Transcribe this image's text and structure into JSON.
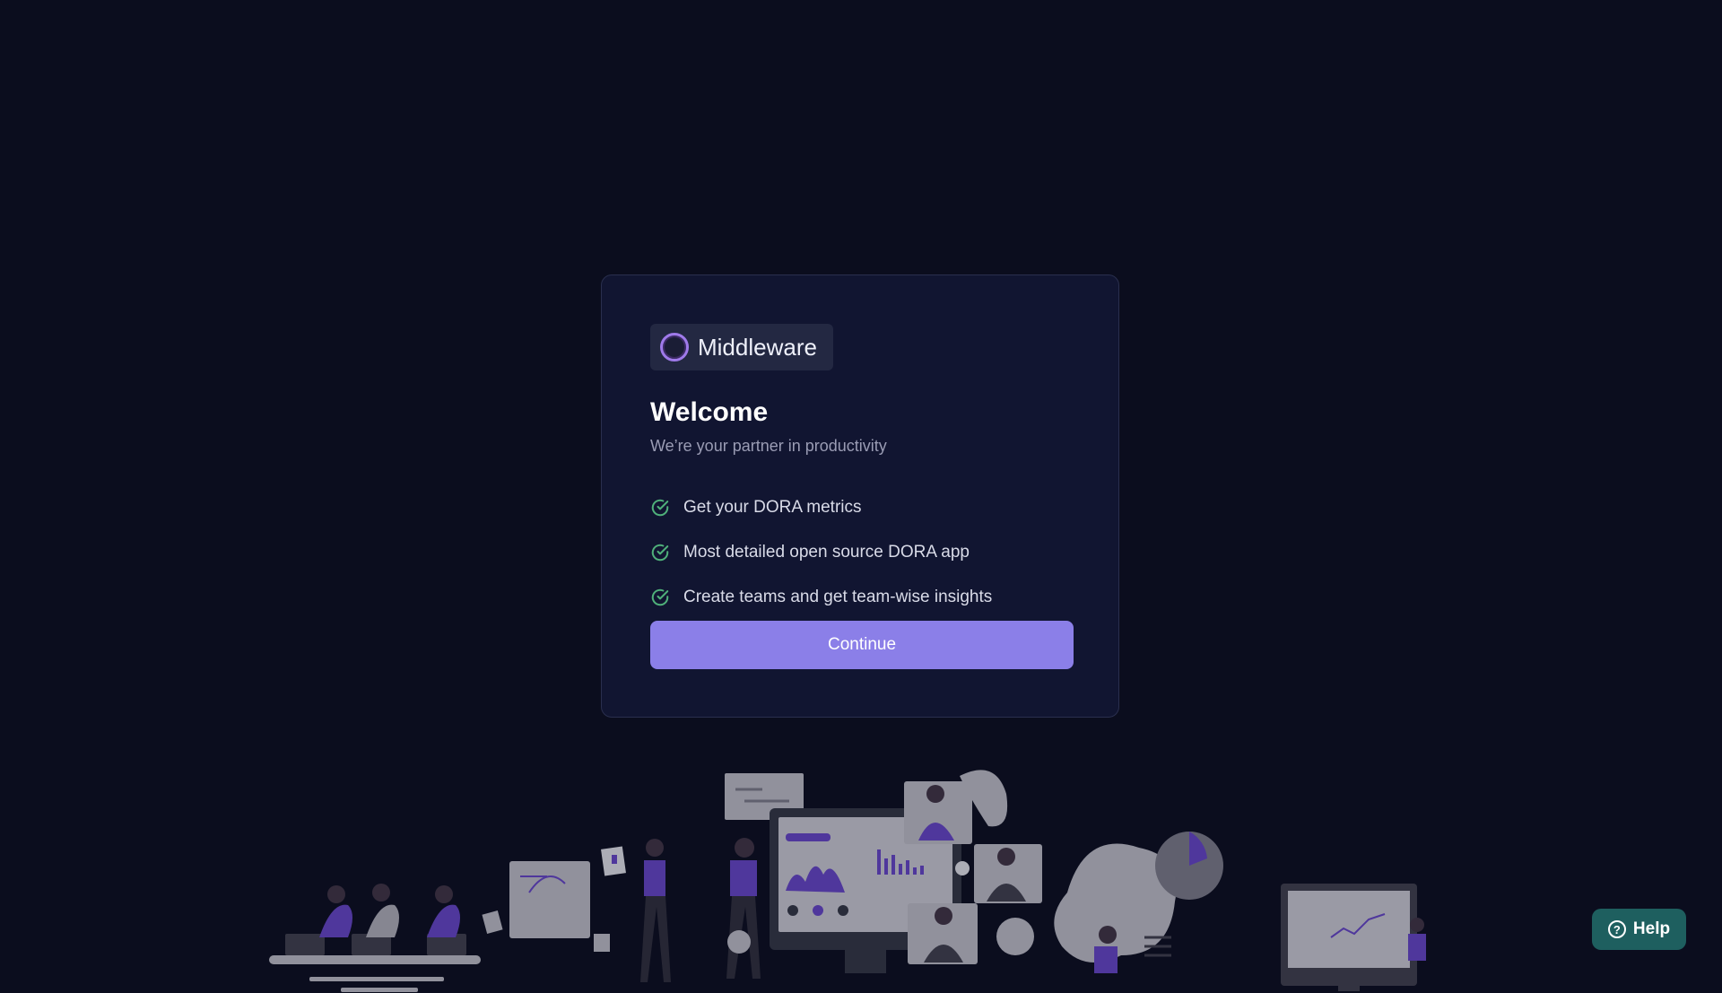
{
  "brand": {
    "name": "Middleware",
    "logo_icon": "ring-logo-icon"
  },
  "welcome": {
    "title": "Welcome",
    "subtitle": "We’re your partner in productivity",
    "features": [
      {
        "icon": "check-circle-icon",
        "label": "Get your DORA metrics"
      },
      {
        "icon": "check-circle-icon",
        "label": "Most detailed open source DORA app"
      },
      {
        "icon": "check-circle-icon",
        "label": "Create teams and get team-wise insights"
      }
    ],
    "continue_label": "Continue"
  },
  "help": {
    "label": "Help",
    "icon": "question-circle-icon",
    "icon_glyph": "?"
  },
  "colors": {
    "background": "#0b0d1e",
    "card": "#111531",
    "accent": "#8b7fe8",
    "check": "#4fb07a",
    "help": "#1e5f5f"
  }
}
